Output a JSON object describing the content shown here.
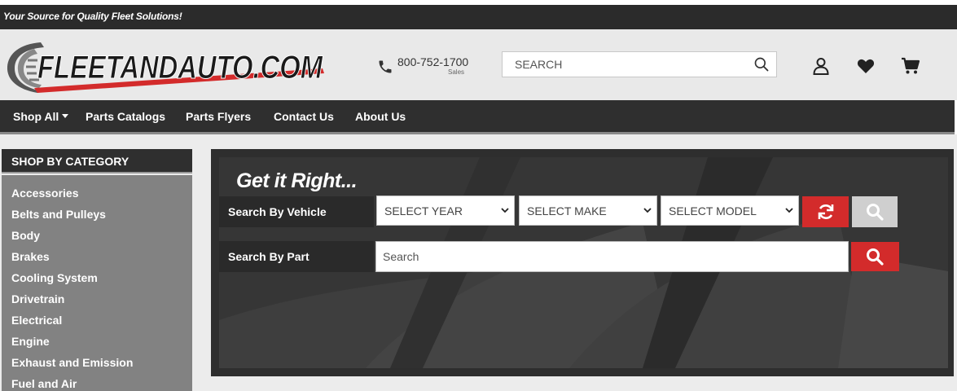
{
  "topbar": {
    "tagline": "Your Source for Quality Fleet Solutions!"
  },
  "header": {
    "logo_text": "FLEETANDAUTO.COM",
    "phone": "800-752-1700",
    "phone_sub": "Sales",
    "search_placeholder": "SEARCH"
  },
  "nav": {
    "items": [
      {
        "label": "Shop All"
      },
      {
        "label": "Parts Catalogs"
      },
      {
        "label": "Parts Flyers"
      },
      {
        "label": "Contact Us"
      },
      {
        "label": "About Us"
      }
    ]
  },
  "sidebar": {
    "title": "SHOP BY CATEGORY",
    "items": [
      {
        "label": "Accessories"
      },
      {
        "label": "Belts and Pulleys"
      },
      {
        "label": "Body"
      },
      {
        "label": "Brakes"
      },
      {
        "label": "Cooling System"
      },
      {
        "label": "Drivetrain"
      },
      {
        "label": "Electrical"
      },
      {
        "label": "Engine"
      },
      {
        "label": "Exhaust and Emission"
      },
      {
        "label": "Fuel and Air"
      }
    ]
  },
  "hero": {
    "title": "Get it Right...",
    "vehicle_label": "Search By Vehicle",
    "year_select": "SELECT YEAR",
    "make_select": "SELECT MAKE",
    "model_select": "SELECT MODEL",
    "part_label": "Search By Part",
    "part_placeholder": "Search"
  },
  "colors": {
    "accent_red": "#d32b2b",
    "dark": "#2f2f2f",
    "sidebar_gray": "#828282"
  },
  "icons": [
    "phone-icon",
    "search-icon",
    "user-icon",
    "heart-icon",
    "cart-icon",
    "chevron-down-icon",
    "refresh-icon"
  ]
}
